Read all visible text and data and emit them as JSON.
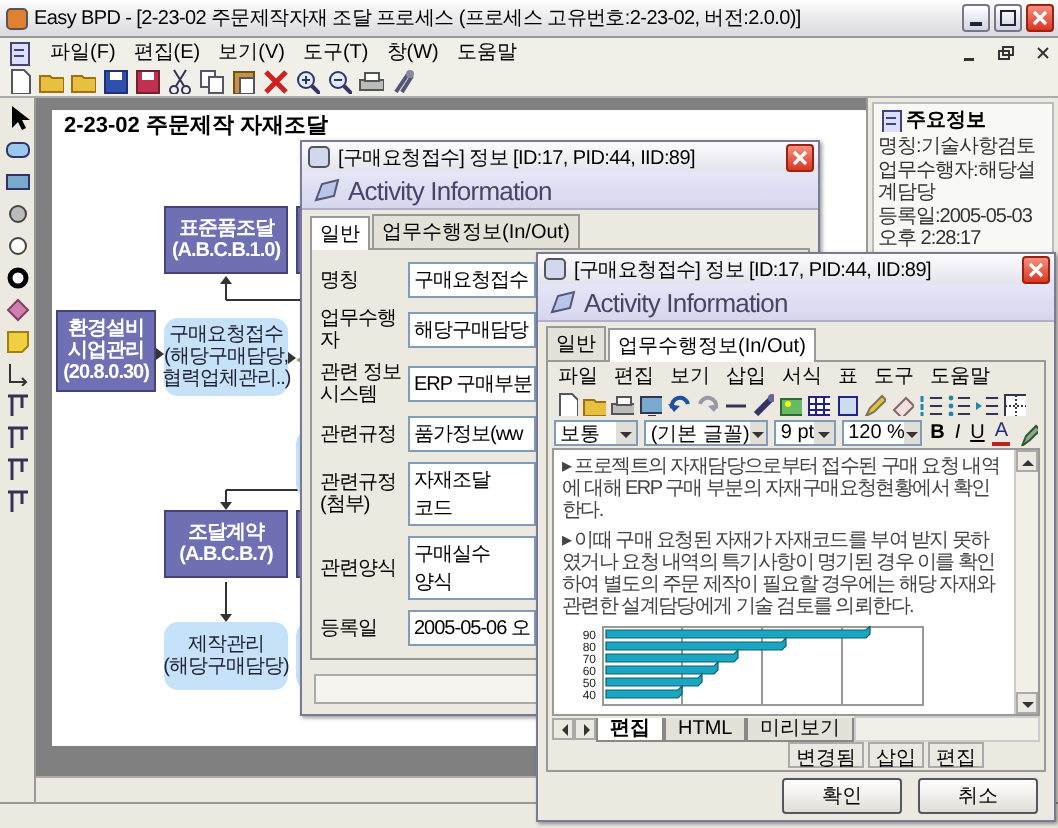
{
  "window": {
    "title": "Easy BPD - [2-23-02 주문제작자재 조달 프로세스 (프로세스 고유번호:2-23-02, 버전:2.0.0)]"
  },
  "menu": [
    "파일(F)",
    "편집(E)",
    "보기(V)",
    "도구(T)",
    "창(W)",
    "도움말"
  ],
  "diagram": {
    "title": "2-23-02 주문제작 자재조달",
    "nodes": [
      {
        "kind": "activity",
        "text": "표준품조달 (A.B.C.B.1.0)"
      },
      {
        "kind": "activity"
      },
      {
        "kind": "activity",
        "text": "환경설비 시업관리 (20.8.0.30)"
      },
      {
        "kind": "task",
        "text": "구매요청접수 (해당구매담당, 협력업체관리..)"
      },
      {
        "kind": "decision"
      },
      {
        "kind": "task"
      },
      {
        "kind": "activity",
        "text": "조달계약 (A.B.C.B.7)"
      },
      {
        "kind": "activity"
      },
      {
        "kind": "task",
        "text": "제작관리 (해당구매담당)"
      },
      {
        "kind": "task"
      }
    ]
  },
  "info_panel": {
    "title": "주요정보",
    "lines": [
      "명칭:기술사항검토",
      "업무수행자:해당설계담당",
      "등록일:2005-05-03 오후 2:28:17"
    ]
  },
  "dialogs": [
    {
      "title": "[구매요청접수] 정보 [ID:17, PID:44, IID:89]",
      "header": "Activity Information",
      "tabs": [
        {
          "label": "일반",
          "selected": true
        },
        {
          "label": "업무수행정보(In/Out)",
          "selected": false
        }
      ],
      "fields": [
        {
          "kind": "line",
          "label": "명칭",
          "value": "구매요청접수"
        },
        {
          "kind": "line",
          "label": "업무수행자",
          "value": "해당구매담당"
        },
        {
          "kind": "line",
          "label": "관련 정보시스템",
          "value": "ERP 구매부분"
        },
        {
          "kind": "line",
          "label": "관련규정",
          "value": "품가정보(ww"
        },
        {
          "kind": "area",
          "label": "관련규정(첨부)",
          "value": "자재조달 코드"
        },
        {
          "kind": "area",
          "label": "관련양식",
          "value": "구매실수 양식"
        },
        {
          "kind": "line",
          "label": "등록일",
          "value": "2005-05-06 오"
        }
      ]
    },
    {
      "title": "[구매요청접수] 정보 [ID:17, PID:44, IID:89]",
      "header": "Activity Information",
      "tabs": [
        {
          "label": "일반",
          "selected": false
        },
        {
          "label": "업무수행정보(In/Out)",
          "selected": true
        }
      ],
      "editor": {
        "menu": [
          "파일",
          "편집",
          "보기",
          "삽입",
          "서식",
          "표",
          "도구",
          "도움말"
        ],
        "selects": [
          "보통",
          "(기본 글꼴)",
          "9 pt",
          "120 %"
        ],
        "format_buttons": [
          "B",
          "I",
          "U",
          "A"
        ],
        "paragraphs": [
          "▸ 프로젝트의 자재담당으로부터 접수된 구매 요청 내역에 대해 ERP 구매 부분의 자재구매요청현황에서 확인한다.",
          "▸ 이때 구매 요청된 자재가 자재코드를 부여 받지 못하였거나 요청 내역의 특기사항이 명기된 경우 이를 확인하여 별도의 주문 제작이 필요할 경우에는 해당 자재와 관련한 설계담당에게 기술 검토를 의뢰한다."
        ],
        "chart_labels": [
          "90",
          "80",
          "70",
          "60",
          "50",
          "40"
        ],
        "view_tabs": [
          {
            "label": "편집",
            "selected": true
          },
          {
            "label": "HTML",
            "selected": false
          },
          {
            "label": "미리보기",
            "selected": false
          }
        ],
        "status": [
          "변경됨",
          "삽입",
          "편집"
        ]
      },
      "buttons": [
        "확인",
        "취소"
      ]
    }
  ]
}
